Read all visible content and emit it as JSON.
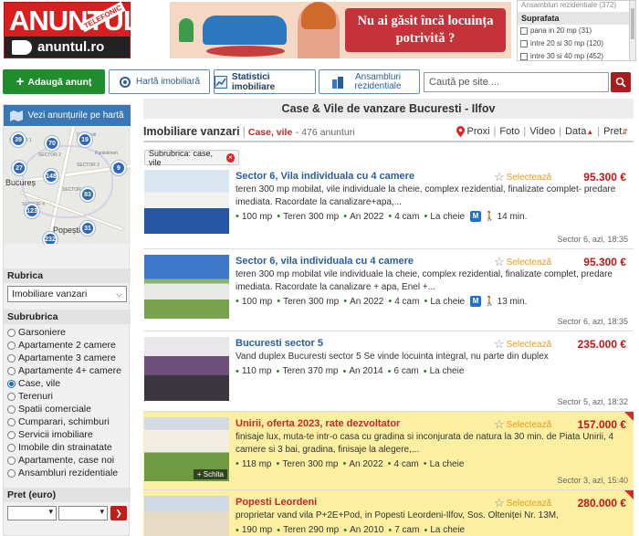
{
  "header": {
    "logo_main": "ANUNTUL",
    "logo_badge": "TELEFONIC",
    "logo_domain": "anuntul.ro",
    "banner_text": "Nu ai găsit încă locuința potrivită ?",
    "surface_filter": {
      "cut_text": "Ansambluri rezidentiale (372)",
      "title": "Suprafata",
      "options": [
        "pana in 20 mp (31)",
        "intre 20 si 30 mp (120)",
        "intre 30 si 40 mp (452)"
      ]
    }
  },
  "nav": {
    "add_label": "Adaugă anunț",
    "map_label": "Hartă imobiliară",
    "stats_label": "Statistici imobiliare",
    "ansambluri_label": "Ansambluri rezidentiale",
    "search_placeholder": "Caută pe site ..."
  },
  "sidebar": {
    "map_button": "Vezi anunțurile pe hartă",
    "map_labels": {
      "city": "Bucureș",
      "popesti": "Popești-Le"
    },
    "map_pins": [
      "39",
      "70",
      "19",
      "27",
      "148",
      "9",
      "83",
      "123",
      "31",
      "232"
    ],
    "rubrica_title": "Rubrica",
    "rubrica_value": "Imobiliare vanzari",
    "subrubrica_title": "Subrubrica",
    "subrubrica": [
      "Garsoniere",
      "Apartamente 2 camere",
      "Apartamente 3 camere",
      "Apartamente 4+ camere",
      "Case, vile",
      "Terenuri",
      "Spatii comerciale",
      "Cumparari, schimburi",
      "Servicii imobiliare",
      "Imobile din strainatate",
      "Apartamente, case noi",
      "Ansambluri rezidentiale"
    ],
    "subrubrica_selected": "Case, vile",
    "pret_title": "Pret (euro)"
  },
  "main": {
    "title": "Case & Vile de vanzare Bucuresti - Ilfov",
    "heading": "Imobiliare vanzari",
    "category": "Case, vile",
    "count": "- 476 anunturi",
    "sorts": {
      "proxi": "Proxi",
      "foto": "Foto",
      "video": "Video",
      "data": "Data",
      "pret": "Pret"
    },
    "tag": "Subrubrica: case, vile",
    "favorite_label": "Selectează",
    "ads": [
      {
        "title": "Sector 6, Vila individuala cu 4 camere",
        "price": "95.300 €",
        "desc": "teren 300 mp mobilat, vile individuale la cheie, complex rezidential, finalizate complet- predare imediata. Racordate la canalizare+apa,...",
        "features": [
          "100 mp",
          "Teren 300 mp",
          "An 2022",
          "4 cam",
          "La cheie"
        ],
        "metro": "M",
        "walk": "14 min.",
        "location": "Sector 6, azi, 18:35"
      },
      {
        "title": "Sector 6, vila individuala cu 4 camere",
        "price": "95.300 €",
        "desc": "teren 300 mp mobilat vile individuale la cheie, complex rezidential, finalizate complet, predare imediata. Racordate la canalizare + apa, Enel +...",
        "features": [
          "100 mp",
          "Teren 300 mp",
          "An 2022",
          "4 cam",
          "La cheie"
        ],
        "metro": "M",
        "walk": "13 min.",
        "location": "Sector 6, azi, 18:35"
      },
      {
        "title": "Bucuresti sector 5",
        "price": "235.000 €",
        "desc": "Vand duplex Bucuresti sector 5 Se vinde locuinta integral, nu parte din duplex",
        "features": [
          "110 mp",
          "Teren 370 mp",
          "An 2014",
          "6 cam",
          "La cheie"
        ],
        "location": "Sector 5, azi, 18:32"
      },
      {
        "title": "Unirii, oferta 2023, rate dezvoltator",
        "price": "157.000 €",
        "desc": "finisaje lux, muta-te intr-o casa cu gradina si inconjurata de natura la 30 min. de Piata Unirii, 4 camere si 3 bai, gradina, finisaje la alegere,...",
        "features": [
          "118 mp",
          "Teren 300 mp",
          "An 2022",
          "4 cam",
          "La cheie"
        ],
        "badge": "+ Schita",
        "location": "Sector 3, azi, 15:40"
      },
      {
        "title": "Popesti Leordeni",
        "price": "280.000 €",
        "desc": "proprietar vand vila P+2E+Pod, in Popesti Leordeni-Ilfov, Sos. Olteniței Nr. 13M,",
        "features": [
          "190 mp",
          "Teren 290 mp",
          "An 2010",
          "7 cam",
          "La cheie"
        ]
      }
    ]
  },
  "colors": {
    "brand_red": "#d81e1e",
    "green_button": "#1f8d2d",
    "link_blue": "#2a5d9c",
    "price_red": "#c31515",
    "promo_yellow": "#fcefa2"
  }
}
